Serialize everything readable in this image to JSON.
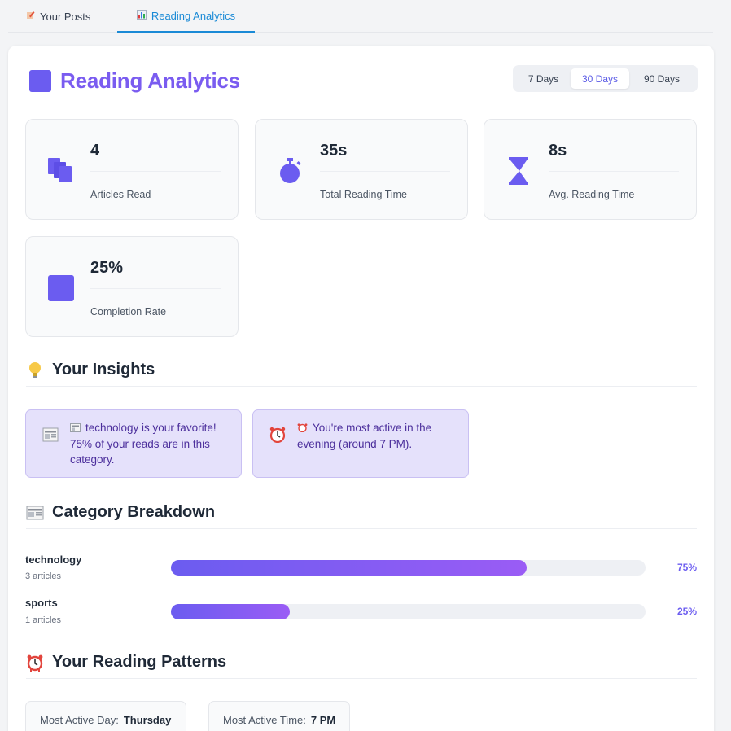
{
  "tabs": [
    {
      "label": "Your Posts",
      "icon": "pencil-icon"
    },
    {
      "label": "Reading Analytics",
      "icon": "bar-chart-icon"
    }
  ],
  "header": {
    "title": "Reading Analytics"
  },
  "range": {
    "options": [
      "7 Days",
      "30 Days",
      "90 Days"
    ],
    "selected": "30 Days"
  },
  "stats": [
    {
      "value": "4",
      "label": "Articles Read",
      "icon": "documents-icon"
    },
    {
      "value": "35s",
      "label": "Total Reading Time",
      "icon": "stopwatch-icon"
    },
    {
      "value": "8s",
      "label": "Avg. Reading Time",
      "icon": "hourglass-icon"
    },
    {
      "value": "25%",
      "label": "Completion Rate",
      "icon": "square-icon"
    }
  ],
  "insights": {
    "title": "Your Insights",
    "items": [
      {
        "text": "technology is your favorite! 75% of your reads are in this category.",
        "icon": "newspaper-icon"
      },
      {
        "text": "You're most active in the evening (around 7 PM).",
        "icon": "alarm-clock-icon"
      }
    ]
  },
  "categories": {
    "title": "Category Breakdown",
    "items": [
      {
        "name": "technology",
        "count": "3 articles",
        "percent": "75%",
        "fraction": 0.75
      },
      {
        "name": "sports",
        "count": "1 articles",
        "percent": "25%",
        "fraction": 0.25
      }
    ]
  },
  "patterns": {
    "title": "Your Reading Patterns",
    "day_label": "Most Active Day:",
    "day_value": "Thursday",
    "time_label": "Most Active Time:",
    "time_value": "7 PM"
  },
  "colors": {
    "accent": "#6b5cf0",
    "tab_active": "#1a8ad6",
    "insight_bg": "#e5e1fb"
  }
}
